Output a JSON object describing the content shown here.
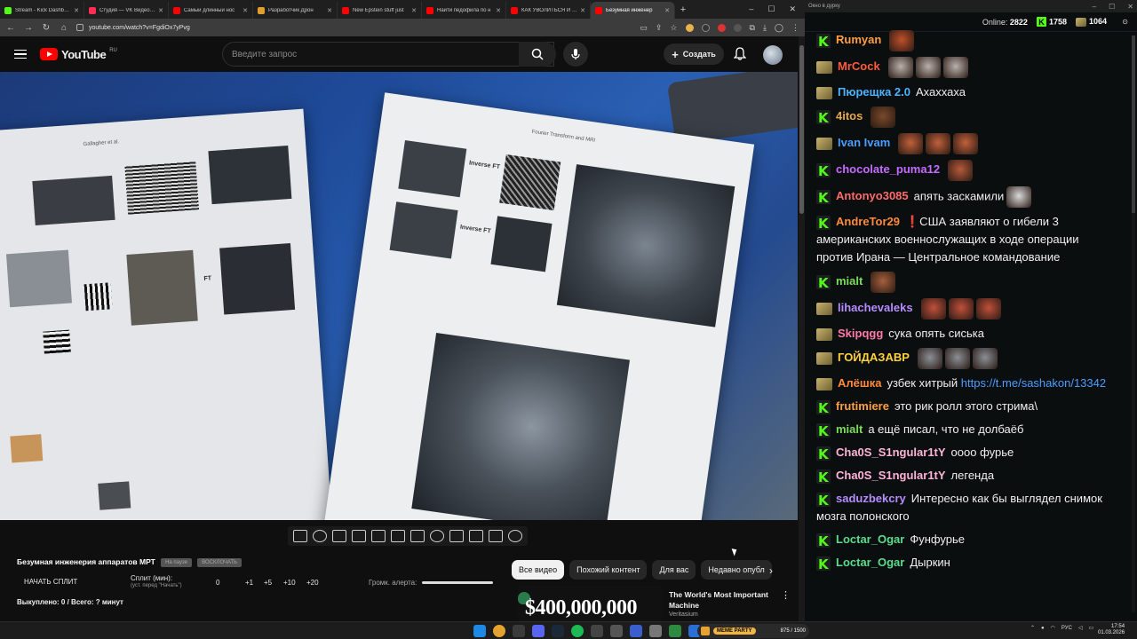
{
  "browser": {
    "tabs": [
      {
        "label": "Stream - Kick Dashboard",
        "color": "#53fc18"
      },
      {
        "label": "Студия — VK Видео Live",
        "color": "#ff2d55"
      },
      {
        "label": "Самый длинный нос",
        "color": "#ff0000"
      },
      {
        "label": "Разработчик Дрон",
        "color": "#e0a030"
      },
      {
        "label": "New Epstein stuff just",
        "color": "#ff0000"
      },
      {
        "label": "Найти педофила по н",
        "color": "#ff0000"
      },
      {
        "label": "КАК УВОЛИТЬСЯ И ПЕ",
        "color": "#ff0000"
      },
      {
        "label": "Безумная инженер",
        "color": "#ff0000",
        "active": true
      }
    ],
    "url": "youtube.com/watch?v=FgdiOx7yPvg"
  },
  "youtube": {
    "logo_text": "YouTube",
    "region": "RU",
    "search_placeholder": "Введите запрос",
    "create_label": "Создать",
    "video_text": {
      "paper1_heading": "Gallagher et al.",
      "paper2_heading": "Fourier Transform and MRI",
      "inverse_ft_1": "Inverse FT",
      "inverse_ft_2": "Inverse FT",
      "ft_label": "FT"
    },
    "info": {
      "title": "Безумная инженерия аппаратов МРТ",
      "badge1": "На паузе",
      "badge2": "ВОСКЛОЧАТЬ",
      "start_split": "НАЧАТЬ СПЛИТ",
      "split_label": "Сплит (мин):",
      "split_sub": "(уст. перед \"Начать\")",
      "split_value": "0",
      "add1": "+1",
      "add5": "+5",
      "add10": "+10",
      "add20": "+20",
      "volume_label": "Громк. алерта:",
      "bought": "Выкуплено: 0 / Всего: ? минут"
    },
    "chips": [
      "Все видео",
      "Похожий контент",
      "Для вас",
      "Недавно опубл"
    ],
    "recommendation": {
      "thumb_text": "$400,000,000",
      "title": "The World's Most Important Machine",
      "channel": "Veritasium"
    }
  },
  "chat": {
    "window_title": "Окно в дурку",
    "online_label": "Online:",
    "online_count": "2822",
    "k_count": "1758",
    "g_count": "1064",
    "messages": [
      {
        "badge": "k",
        "user": "Rumyan",
        "color": "#ff9f43",
        "text": "",
        "emotes": [
          "#c0502a"
        ]
      },
      {
        "badge": "g",
        "user": "MrCock",
        "color": "#ff5a3c",
        "text": "",
        "emotes": [
          "#b9b1ab",
          "#b9b1ab",
          "#b9b1ab"
        ]
      },
      {
        "badge": "g",
        "user": "Пюрещка 2.0",
        "color": "#4bb3ff",
        "text": "Ахаххаха",
        "emotes": []
      },
      {
        "badge": "k",
        "user": "4itos",
        "color": "#e7a94a",
        "text": "",
        "emotes": [
          "#7a4a2a"
        ]
      },
      {
        "badge": "g",
        "user": "Ivan Ivam",
        "color": "#4b9dff",
        "text": "",
        "emotes": [
          "#c0603a",
          "#c0603a",
          "#c0603a"
        ]
      },
      {
        "badge": "k",
        "user": "chocolate_puma12",
        "color": "#c56bff",
        "text": "",
        "emotes": [
          "#b65a3a"
        ]
      },
      {
        "badge": "k",
        "user": "Antonyo3085",
        "color": "#ff6b6b",
        "text": "апять заскамили",
        "emotes": [
          "#d9d9d9"
        ]
      },
      {
        "badge": "k",
        "user": "AndreTor29",
        "color": "#ff8a3c",
        "text": "❗США заявляют о гибели 3 американских военнослужащих в ходе операции против Ирана — Центральное командование",
        "emotes": []
      },
      {
        "badge": "k",
        "user": "mialt",
        "color": "#7ddc5a",
        "text": "",
        "emotes": [
          "#a5603c"
        ]
      },
      {
        "badge": "g",
        "user": "lihachevaleks",
        "color": "#b58cff",
        "text": "",
        "emotes": [
          "#c0503a",
          "#c0503a",
          "#c0503a"
        ]
      },
      {
        "badge": "g",
        "user": "Skipqgg",
        "color": "#ff7aa8",
        "text": "сука опять сиська",
        "emotes": []
      },
      {
        "badge": "g",
        "user": "ГОЙДАЗАВР",
        "color": "#ffd23c",
        "text": "",
        "emotes": [
          "#8a8f96",
          "#8a8f96",
          "#8a8f96"
        ]
      },
      {
        "badge": "g",
        "user": "Алёшка",
        "color": "#ff8a3c",
        "text": "узбек хитрый",
        "link": "https://t.me/sashakon/13342",
        "emotes": []
      },
      {
        "badge": "k",
        "user": "frutimiere",
        "color": "#ff9f43",
        "text": "это рик ролл этого стрима\\",
        "emotes": []
      },
      {
        "badge": "k",
        "user": "mialt",
        "color": "#7ddc5a",
        "text": "а ещё писал, что не долбаёб",
        "emotes": []
      },
      {
        "badge": "k",
        "user": "Cha0S_S1ngular1tY",
        "color": "#ffb3d9",
        "text": "оооо фурье",
        "emotes": []
      },
      {
        "badge": "k",
        "user": "Cha0S_S1ngular1tY",
        "color": "#ffb3d9",
        "text": "легенда",
        "emotes": []
      },
      {
        "badge": "k",
        "user": "saduzbekcry",
        "color": "#b58cff",
        "text": "Интересно как бы выглядел снимок мозга полонского",
        "emotes": []
      },
      {
        "badge": "k",
        "user": "Loctar_Ogar",
        "color": "#5adc8c",
        "text": "Фунфурье",
        "emotes": []
      },
      {
        "badge": "k",
        "user": "Loctar_Ogar",
        "color": "#5adc8c",
        "text": "Дыркин",
        "emotes": []
      }
    ]
  },
  "taskbar": {
    "widget_title": "MEME PARTY",
    "widget_value": "875 / 1500",
    "lang": "РУС",
    "time": "17:54",
    "date": "01.03.2026"
  }
}
